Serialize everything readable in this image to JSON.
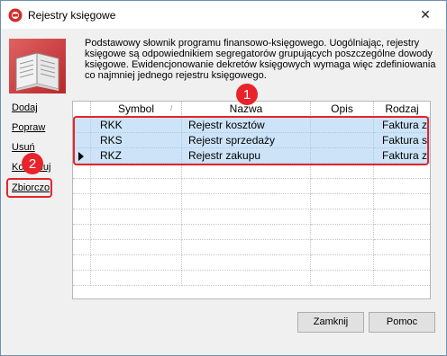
{
  "window": {
    "title": "Rejestry księgowe",
    "close_glyph": "✕"
  },
  "description": "Podstawowy słownik programu finansowo-księgowego. Uogólniając, rejestry księgowe są odpowiednikiem segregatorów grupujących poszczególne dowody księgowe. Ewidencjonowanie dekretów księgowych wymaga więc zdefiniowania co najmniej jednego rejestru księgowego.",
  "sidebar": {
    "items": [
      {
        "label": "Dodaj"
      },
      {
        "label": "Popraw"
      },
      {
        "label": "Usuń"
      },
      {
        "label": "Kontroluj"
      },
      {
        "label": "Zbiorczo"
      }
    ]
  },
  "grid": {
    "columns": [
      "Symbol",
      "Nazwa",
      "Opis",
      "Rodzaj dow"
    ],
    "rows": [
      {
        "symbol": "RKK",
        "nazwa": "Rejestr kosztów",
        "opis": "",
        "rodzaj": "Faktura z",
        "selected": true,
        "current": false
      },
      {
        "symbol": "RKS",
        "nazwa": "Rejestr sprzedaży",
        "opis": "",
        "rodzaj": "Faktura s",
        "selected": true,
        "current": false
      },
      {
        "symbol": "RKZ",
        "nazwa": "Rejestr zakupu",
        "opis": "",
        "rodzaj": "Faktura z",
        "selected": true,
        "current": true
      }
    ]
  },
  "callouts": [
    "1",
    "2"
  ],
  "buttons": {
    "close_label": "Zamknij",
    "help_label": "Pomoc"
  },
  "colors": {
    "accent_red": "#e8232b",
    "selection": "#cde4f8"
  }
}
